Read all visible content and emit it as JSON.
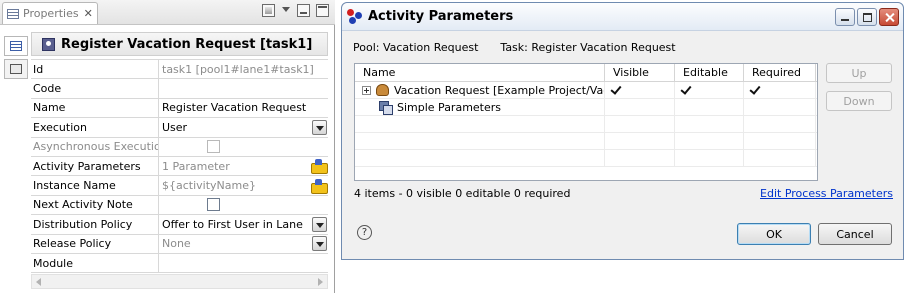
{
  "properties_view": {
    "tab_title": "Properties",
    "header": "Register Vacation Request [task1]",
    "rows": [
      {
        "label": "Id",
        "value": "task1  [pool1#lane1#task1]",
        "kind": "readonly"
      },
      {
        "label": "Code",
        "value": "",
        "kind": "text"
      },
      {
        "label": "Name",
        "value": "Register Vacation Request",
        "kind": "text"
      },
      {
        "label": "Execution",
        "value": "User",
        "kind": "dropdown"
      },
      {
        "label": "Asynchronous Execution",
        "value": "",
        "kind": "checkbox-disabled"
      },
      {
        "label": "Activity Parameters",
        "value": "1 Parameter",
        "kind": "param"
      },
      {
        "label": "Instance Name",
        "value": "${activityName}",
        "kind": "param"
      },
      {
        "label": "Next Activity Note",
        "value": "",
        "kind": "checkbox"
      },
      {
        "label": "Distribution Policy",
        "value": "Offer to First User in Lane",
        "kind": "dropdown"
      },
      {
        "label": "Release Policy",
        "value": "None",
        "kind": "dropdown"
      },
      {
        "label": "Module",
        "value": "",
        "kind": "text"
      }
    ]
  },
  "dialog": {
    "title": "Activity Parameters",
    "pool": "Pool: Vacation Request",
    "task": "Task: Register Vacation Request",
    "columns": [
      "Name",
      "Visible",
      "Editable",
      "Required"
    ],
    "rows": [
      {
        "name": "Vacation Request [Example Project/Vacatio",
        "visible": true,
        "editable": true,
        "required": true
      },
      {
        "name": "Simple Parameters",
        "visible": false,
        "editable": false,
        "required": false
      }
    ],
    "up_label": "Up",
    "down_label": "Down",
    "status": "4 items - 0 visible  0 editable  0 required",
    "link": "Edit Process Parameters",
    "help": "?",
    "ok_label": "OK",
    "cancel_label": "Cancel"
  },
  "icons": [
    "properties-icon",
    "close-icon",
    "view-menu-icon",
    "minimize-icon",
    "maximize-icon",
    "pin-icon",
    "task-icon",
    "dropdown-arrow-icon",
    "parameter-icon",
    "expand-icon",
    "business-object-icon",
    "parameter-group-icon",
    "checkmark-icon",
    "help-icon",
    "app-icon"
  ],
  "colors": {
    "link": "#0033cc",
    "title_bar": "#e3ebf5",
    "header_bg": "#e6e6e6"
  }
}
